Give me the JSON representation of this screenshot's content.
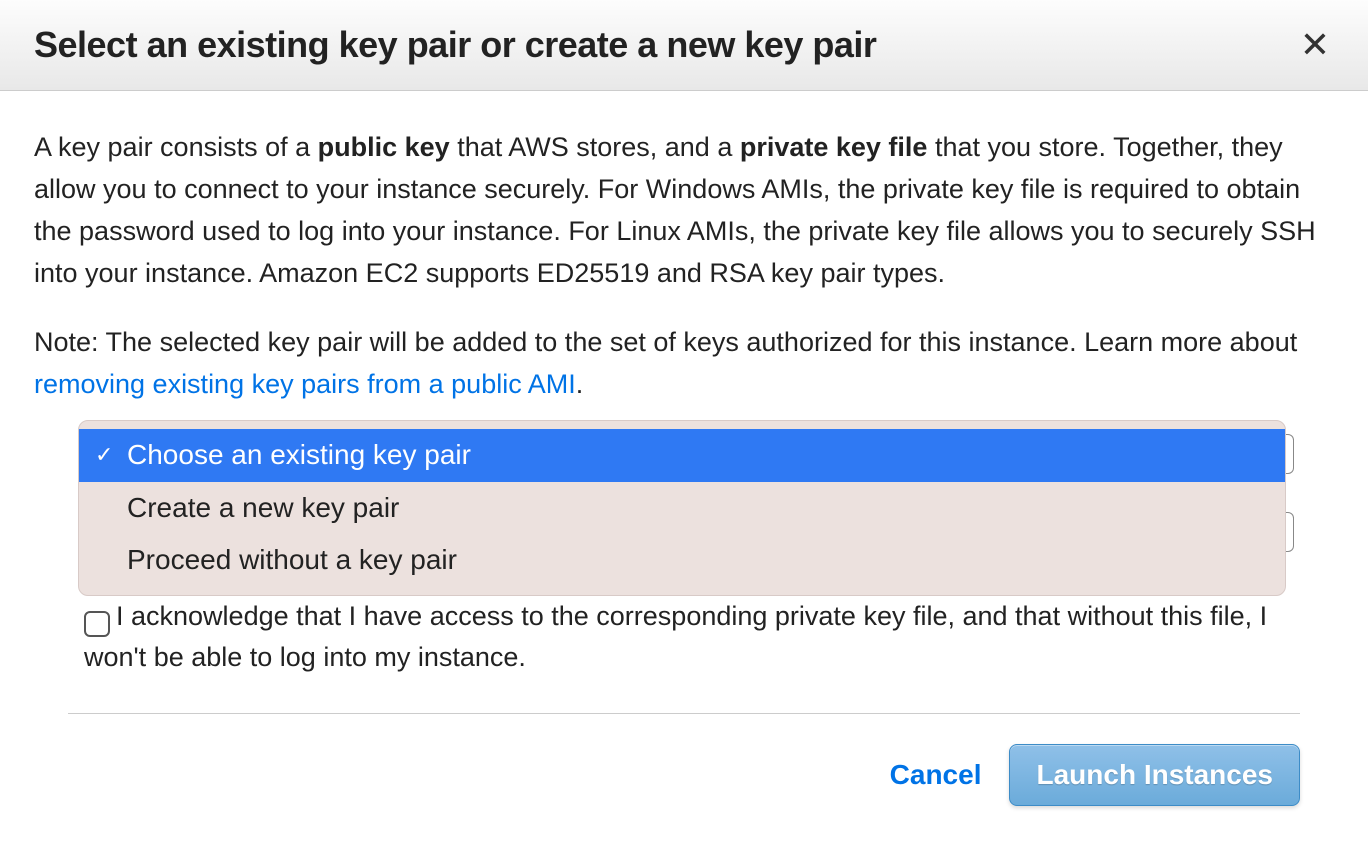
{
  "header": {
    "title": "Select an existing key pair or create a new key pair"
  },
  "body": {
    "desc_part1": "A key pair consists of a ",
    "desc_bold1": "public key",
    "desc_part2": " that AWS stores, and a ",
    "desc_bold2": "private key file",
    "desc_part3": " that you store. Together, they allow you to connect to your instance securely. For Windows AMIs, the private key file is required to obtain the password used to log into your instance. For Linux AMIs, the private key file allows you to securely SSH into your instance. Amazon EC2 supports ED25519 and RSA key pair types.",
    "note_part1": "Note: The selected key pair will be added to the set of keys authorized for this instance. Learn more about ",
    "note_link": "removing existing key pairs from a public AMI",
    "note_part2": ".",
    "dropdown": {
      "options": [
        "Choose an existing key pair",
        "Create a new key pair",
        "Proceed without a key pair"
      ],
      "check": "✓"
    },
    "acknowledge": "I acknowledge that I have access to the corresponding private key file, and that without this file, I won't be able to log into my instance."
  },
  "footer": {
    "cancel": "Cancel",
    "launch": "Launch Instances"
  }
}
